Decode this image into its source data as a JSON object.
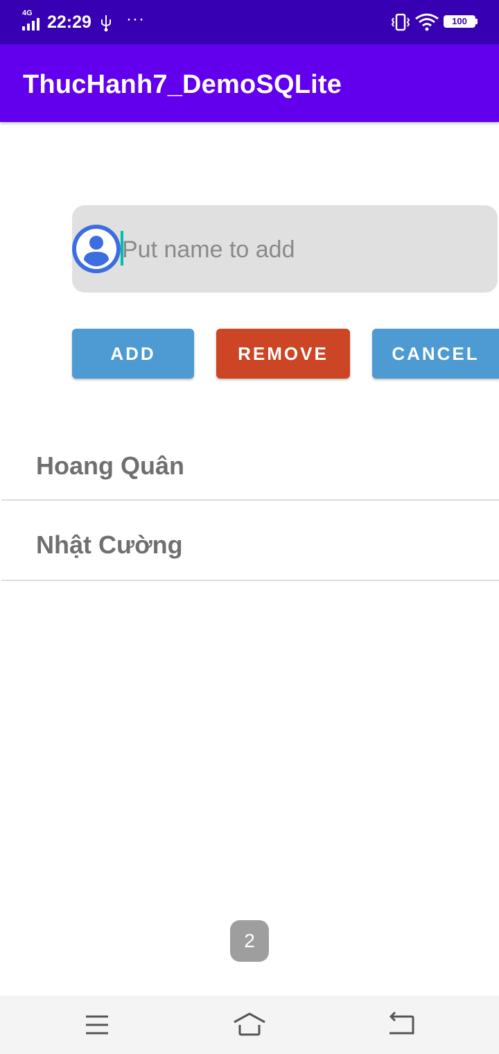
{
  "status_bar": {
    "network": "4G",
    "time": "22:29",
    "more": "···",
    "battery": "100"
  },
  "app_bar": {
    "title": "ThucHanh7_DemoSQLite"
  },
  "form": {
    "name_placeholder": "Put name to add",
    "name_value": ""
  },
  "buttons": {
    "add": "ADD",
    "remove": "REMOVE",
    "cancel": "CANCEL"
  },
  "list": {
    "items": [
      "Hoang Quân",
      "Nhật Cường"
    ]
  },
  "toast": {
    "text": "2"
  },
  "colors": {
    "status_bar": "#3700b3",
    "app_bar": "#6200ee",
    "add_button": "#4e9bd3",
    "remove_button": "#cc4524",
    "cancel_button": "#4e9bd3",
    "avatar": "#3d6ee0"
  },
  "icons": {
    "avatar": "person-icon",
    "nav_menu": "menu-icon",
    "nav_home": "home-icon",
    "nav_back": "back-icon"
  }
}
